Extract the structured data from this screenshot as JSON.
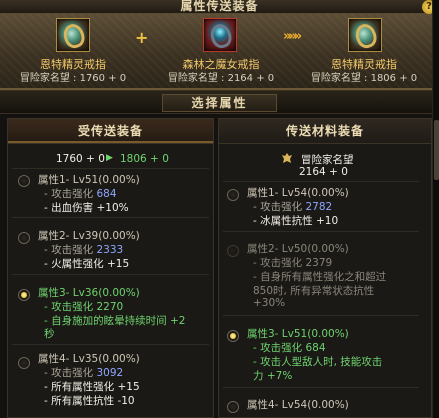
{
  "header": {
    "title": "属性传送装备",
    "help": "?"
  },
  "transfer": {
    "source": {
      "name": "恩特精灵戒指",
      "fame": "冒险家名望 : 1760 + 0"
    },
    "material": {
      "name": "森林之魔女戒指",
      "fame": "冒险家名望 : 2164 + 0"
    },
    "result": {
      "name": "恩特精灵戒指",
      "fame": "冒险家名望 : 1806 + 0"
    },
    "plus": "+",
    "arrows": "»»»"
  },
  "select_label": "选择属性",
  "left_panel": {
    "title": "受传送装备",
    "fame_from": "1760 + 0",
    "fame_arrow": "▶",
    "fame_to": "1806 + 0",
    "options": [
      {
        "title": "属性1- Lv51(0.00%)",
        "lines": [
          "- 攻击强化 ",
          "- 出血伤害 +10%"
        ],
        "value": "684"
      },
      {
        "title": "属性2- Lv39(0.00%)",
        "lines": [
          "- 攻击强化 ",
          "- 火属性强化 +15"
        ],
        "value": "2333"
      },
      {
        "title": "属性3- Lv36(0.00%)",
        "lines": [
          "- 攻击强化 ",
          "- 自身施加的眩晕持续时间 +2",
          "秒"
        ],
        "value": "2270"
      },
      {
        "title": "属性4- Lv35(0.00%)",
        "lines": [
          "- 攻击强化 ",
          "- 所有属性强化 +15",
          "- 所有属性抗性 -10"
        ],
        "value": "3092"
      }
    ]
  },
  "right_panel": {
    "title": "传送材料装备",
    "fame_label": "冒险家名望",
    "fame_value": "2164 + 0",
    "options": [
      {
        "title": "属性1- Lv54(0.00%)",
        "lines": [
          "- 攻击强化 ",
          "- 冰属性抗性 +10"
        ],
        "value": "2782"
      },
      {
        "title": "属性2- Lv50(0.00%)",
        "lines": [
          "- 攻击强化 2379",
          "- 自身所有属性强化之和超过",
          "850时, 所有异常状态抗性",
          "+30%"
        ]
      },
      {
        "title": "属性3- Lv51(0.00%)",
        "lines": [
          "- 攻击强化 684",
          "- 攻击人型敌人时, 技能攻击",
          "力 +7%"
        ]
      },
      {
        "title": "属性4- Lv54(0.00%)"
      }
    ]
  },
  "colors": {
    "gold": "#f3c96a",
    "green": "#6ed36e",
    "blue": "#8fa6ff"
  }
}
